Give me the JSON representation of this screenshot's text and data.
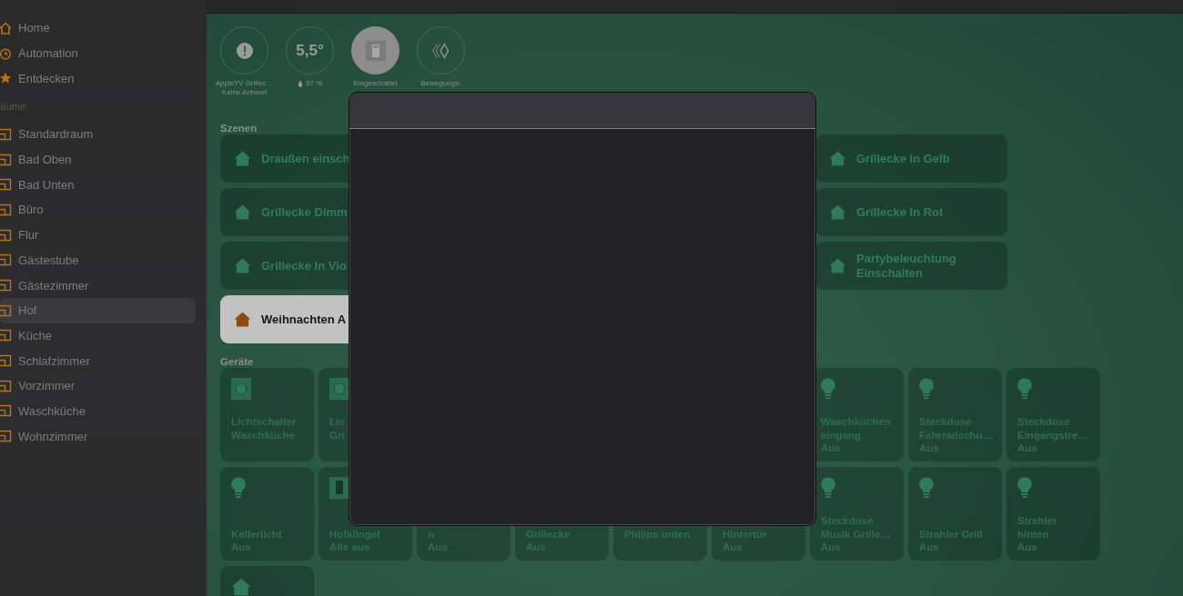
{
  "sidebar": {
    "nav": [
      {
        "label": "Home",
        "kind": "home",
        "selected": false
      },
      {
        "label": "Automation",
        "kind": "clock",
        "selected": false
      },
      {
        "label": "Entdecken",
        "kind": "star",
        "selected": false
      }
    ],
    "section_title": "äume",
    "rooms": [
      {
        "label": "Standardraum",
        "selected": false
      },
      {
        "label": "Bad Oben",
        "selected": false
      },
      {
        "label": "Bad Unten",
        "selected": false
      },
      {
        "label": "Büro",
        "selected": false
      },
      {
        "label": "Flur",
        "selected": false
      },
      {
        "label": "Gästestube",
        "selected": false
      },
      {
        "label": "Gästezimmer",
        "selected": false
      },
      {
        "label": "Hof",
        "selected": true
      },
      {
        "label": "Küche",
        "selected": false
      },
      {
        "label": "Schlafzimmer",
        "selected": false
      },
      {
        "label": "Vorzimmer",
        "selected": false
      },
      {
        "label": "Waschküche",
        "selected": false
      },
      {
        "label": "Wohnzimmer",
        "selected": false
      }
    ]
  },
  "accessories": [
    {
      "kind": "warning",
      "on": false,
      "lines": [
        "AppleTV Grillec…",
        "Keine Antwort"
      ]
    },
    {
      "kind": "temperature",
      "on": false,
      "reading": "5,5°",
      "humidity": "97 %"
    },
    {
      "kind": "switch",
      "on": true,
      "lines": [
        "Eingeschaltet"
      ]
    },
    {
      "kind": "motion",
      "on": false,
      "lines": [
        "Bewegungs-"
      ]
    }
  ],
  "scenes": {
    "title": "Szenen",
    "rows": [
      {
        "left": {
          "name": "Draußen einsch",
          "selected": false
        },
        "right": {
          "name": "Grillecke In Gelb",
          "selected": false
        }
      },
      {
        "left": {
          "name": "Grillecke Dimm",
          "selected": false
        },
        "right": {
          "name": "Grillecke In Rot",
          "selected": false
        }
      },
      {
        "left": {
          "name": "Grillecke In Vio",
          "selected": false
        },
        "right": {
          "name": "Partybeleuchtung Einschalten",
          "selected": false
        }
      },
      {
        "left": {
          "name": "Weihnachten A",
          "selected": true
        }
      }
    ]
  },
  "devices": {
    "title": "Geräte",
    "rows": [
      {
        "left": [
          {
            "kind": "switch",
            "lines": [
              "Lichtschalter",
              "Waschküche"
            ]
          },
          {
            "kind": "switch",
            "lines": [
              "Lic",
              "Gri"
            ]
          }
        ],
        "right": [
          {
            "kind": "bulb",
            "lines": [
              "Waschküchen",
              "eingang"
            ],
            "status": "Aus"
          },
          {
            "kind": "bulb",
            "lines": [
              "Steckdose",
              "Fahrradschu…"
            ],
            "status": "Aus"
          },
          {
            "kind": "bulb",
            "lines": [
              "Steckdose",
              "Eingangstre…"
            ],
            "status": "Aus"
          }
        ]
      },
      {
        "left": [
          {
            "kind": "bulb",
            "lines": [
              "Kellerlicht"
            ],
            "status": "Aus"
          },
          {
            "kind": "doorbell",
            "lines": [
              "Hofklingel"
            ],
            "status": "Alle aus"
          },
          {
            "kind": "covered",
            "lines": [
              "n"
            ],
            "status": "Aus"
          },
          {
            "kind": "covered",
            "lines": [
              "Grillecke"
            ],
            "status": "Aus"
          },
          {
            "kind": "covered",
            "lines": [
              "Philips unten"
            ]
          },
          {
            "kind": "covered",
            "lines": [
              "Hintertür"
            ],
            "status": "Aus"
          },
          {
            "kind": "bulb",
            "lines": [
              "Steckdose",
              "Musik Grille…"
            ],
            "status": "Aus"
          },
          {
            "kind": "bulb",
            "lines": [
              "Strahler Grill"
            ],
            "status": "Aus"
          },
          {
            "kind": "bulb",
            "lines": [
              "Strahler",
              "hinten"
            ],
            "status": "Aus"
          }
        ]
      },
      {
        "left": [
          {
            "kind": "house"
          }
        ]
      }
    ]
  }
}
